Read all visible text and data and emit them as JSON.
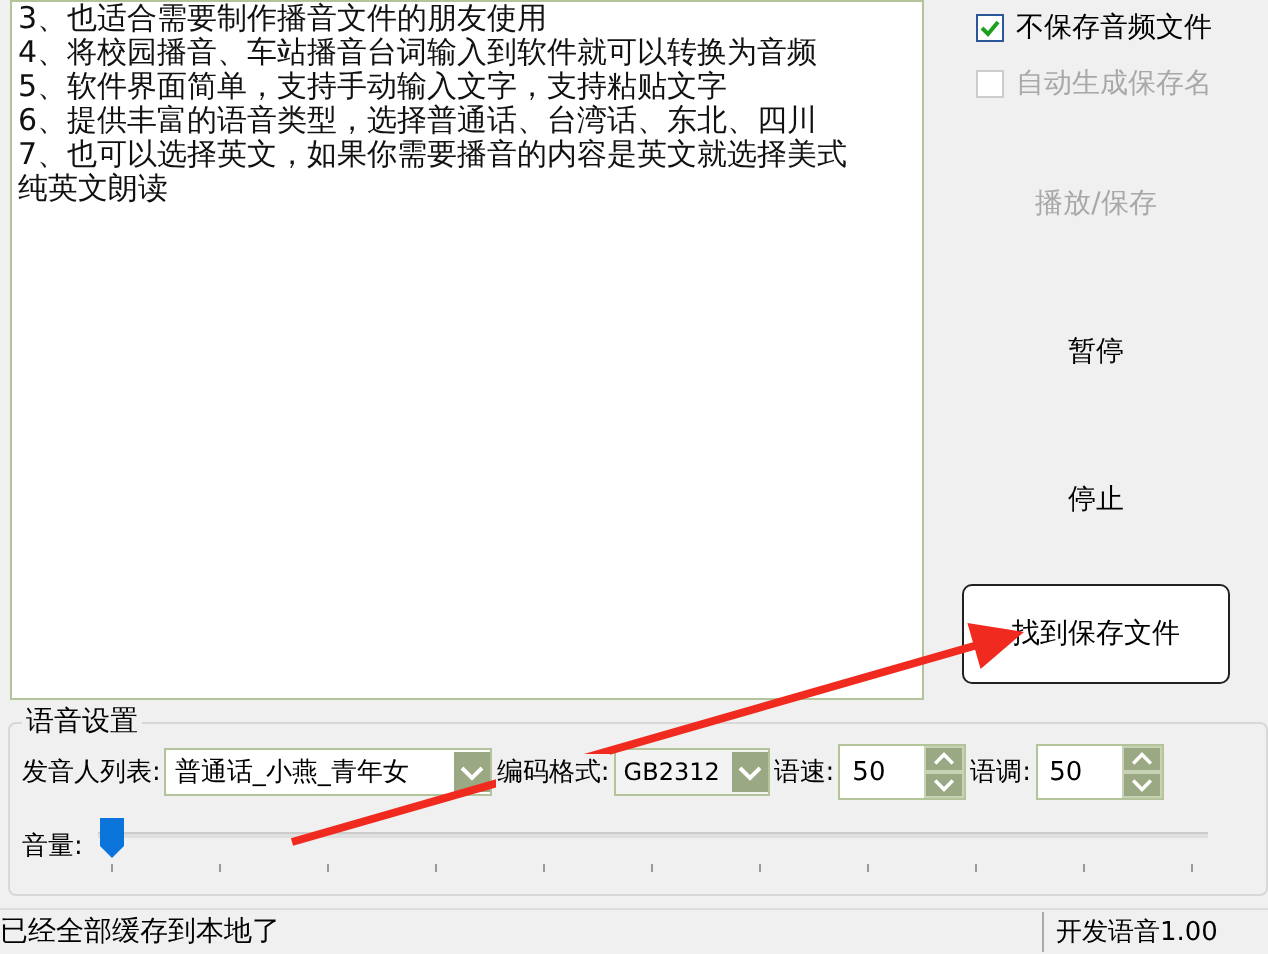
{
  "text_area": {
    "lines": [
      "3、也适合需要制作播音文件的朋友使用",
      "4、将校园播音、车站播音台词输入到软件就可以转换为音频",
      "5、软件界面简单，支持手动输入文字，支持粘贴文字",
      "6、提供丰富的语音类型，选择普通话、台湾话、东北、四川",
      "7、也可以选择英文，如果你需要播音的内容是英文就选择美式纯英文朗读"
    ]
  },
  "options": [
    {
      "label": "不保存音频文件",
      "checked": true,
      "disabled": false
    },
    {
      "label": "自动生成保存名",
      "checked": false,
      "disabled": true
    }
  ],
  "buttons": [
    {
      "label": "播放/保存",
      "disabled": true,
      "kind": "flat"
    },
    {
      "label": "暂停",
      "disabled": false,
      "kind": "flat"
    },
    {
      "label": "停止",
      "disabled": false,
      "kind": "flat"
    },
    {
      "label": "找到保存文件",
      "disabled": false,
      "kind": "outlined"
    }
  ],
  "voice_settings": {
    "title": "语音设置",
    "speaker": {
      "label": "发音人列表:",
      "value": "普通话_小燕_青年女"
    },
    "encoding": {
      "label": "编码格式:",
      "value": "GB2312"
    },
    "speed": {
      "label": "语速:",
      "value": "50"
    },
    "pitch": {
      "label": "语调:",
      "value": "50"
    },
    "volume": {
      "label": "音量:",
      "level": 0
    }
  },
  "status_bar": {
    "message": "已经全部缓存到本地了",
    "version": "开发语音1.00"
  }
}
